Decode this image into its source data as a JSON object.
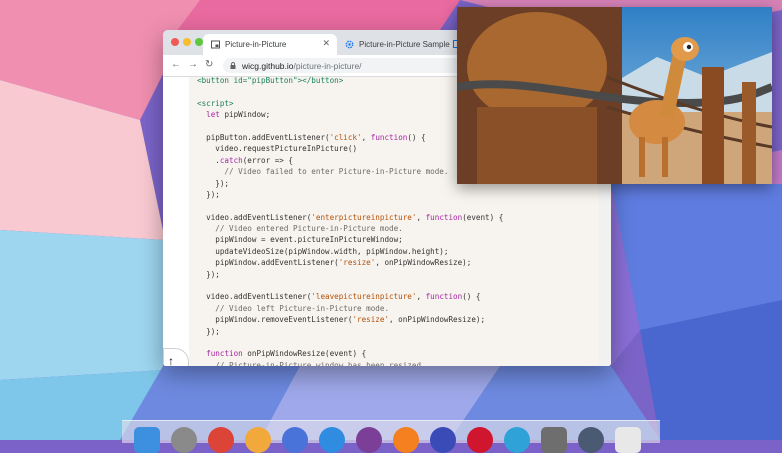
{
  "browser": {
    "tabs": [
      {
        "title": "Picture-in-Picture",
        "active": true
      },
      {
        "title": "Picture-in-Picture Sample",
        "active": false
      }
    ],
    "address": {
      "host": "wicg.github.io",
      "path": "/picture-in-picture/"
    }
  },
  "code_lines": [
    [
      {
        "t": "<button id=\"pipButton\"></button>",
        "c": "t"
      }
    ],
    [],
    [
      {
        "t": "<script>",
        "c": "t"
      }
    ],
    [
      {
        "t": "  "
      },
      {
        "t": "let",
        "c": "k"
      },
      {
        "t": " pipWindow;"
      }
    ],
    [],
    [
      {
        "t": "  pipButton.addEventListener("
      },
      {
        "t": "'click'",
        "c": "s"
      },
      {
        "t": ", "
      },
      {
        "t": "function",
        "c": "k"
      },
      {
        "t": "() {"
      }
    ],
    [
      {
        "t": "    video.requestPictureInPicture()"
      }
    ],
    [
      {
        "t": "    ."
      },
      {
        "t": "catch",
        "c": "k"
      },
      {
        "t": "(error => {"
      }
    ],
    [
      {
        "t": "      // Video failed to enter Picture-in-Picture mode.",
        "c": "c"
      }
    ],
    [
      {
        "t": "    });"
      }
    ],
    [
      {
        "t": "  });"
      }
    ],
    [],
    [
      {
        "t": "  video.addEventListener("
      },
      {
        "t": "'enterpictureinpicture'",
        "c": "s"
      },
      {
        "t": ", "
      },
      {
        "t": "function",
        "c": "k"
      },
      {
        "t": "(event) {"
      }
    ],
    [
      {
        "t": "    // Video entered Picture-in-Picture mode.",
        "c": "c"
      }
    ],
    [
      {
        "t": "    pipWindow = event.pictureInPictureWindow;"
      }
    ],
    [
      {
        "t": "    updateVideoSize(pipWindow.width, pipWindow.height);"
      }
    ],
    [
      {
        "t": "    pipWindow.addEventListener("
      },
      {
        "t": "'resize'",
        "c": "s"
      },
      {
        "t": ", onPipWindowResize);"
      }
    ],
    [
      {
        "t": "  });"
      }
    ],
    [],
    [
      {
        "t": "  video.addEventListener("
      },
      {
        "t": "'leavepictureinpicture'",
        "c": "s"
      },
      {
        "t": ", "
      },
      {
        "t": "function",
        "c": "k"
      },
      {
        "t": "() {"
      }
    ],
    [
      {
        "t": "    // Video left Picture-in-Picture mode.",
        "c": "c"
      }
    ],
    [
      {
        "t": "    pipWindow.removeEventListener("
      },
      {
        "t": "'resize'",
        "c": "s"
      },
      {
        "t": ", onPipWindowResize);"
      }
    ],
    [
      {
        "t": "  });"
      }
    ],
    [],
    [
      {
        "t": "  "
      },
      {
        "t": "function",
        "c": "k"
      },
      {
        "t": " onPipWindowResize(event) {"
      }
    ],
    [
      {
        "t": "    // Picture-in-Picture window has been resized.",
        "c": "c"
      }
    ]
  ],
  "floating_buttons": [
    {
      "icon": "arrow-up-icon",
      "glyph": "↑"
    },
    {
      "icon": "arrow-right-icon",
      "glyph": "→"
    }
  ],
  "pip_window": {
    "content": "video-playback"
  },
  "dock": {
    "icons": [
      "finder-icon",
      "launchpad-icon",
      "chrome-icon",
      "chrome-canary-icon",
      "chromium-icon",
      "safari-icon",
      "tor-icon",
      "firefox-icon",
      "firefox-nightly-icon",
      "opera-icon",
      "edge-icon",
      "system-preferences-icon",
      "app-icon",
      "trash-icon"
    ],
    "colors": [
      "#3d8fe0",
      "#8a8a8a",
      "#db4437",
      "#f2a93b",
      "#4a73d9",
      "#2f8ce0",
      "#7b3f98",
      "#f58020",
      "#3a4bb8",
      "#d0162f",
      "#2fa2d8",
      "#6e6e6e",
      "#4a5a72",
      "#e8e8e8"
    ]
  },
  "colors": {
    "wallpaper_primary": "#7a62c9",
    "page_bg": "#f7f3ee"
  }
}
